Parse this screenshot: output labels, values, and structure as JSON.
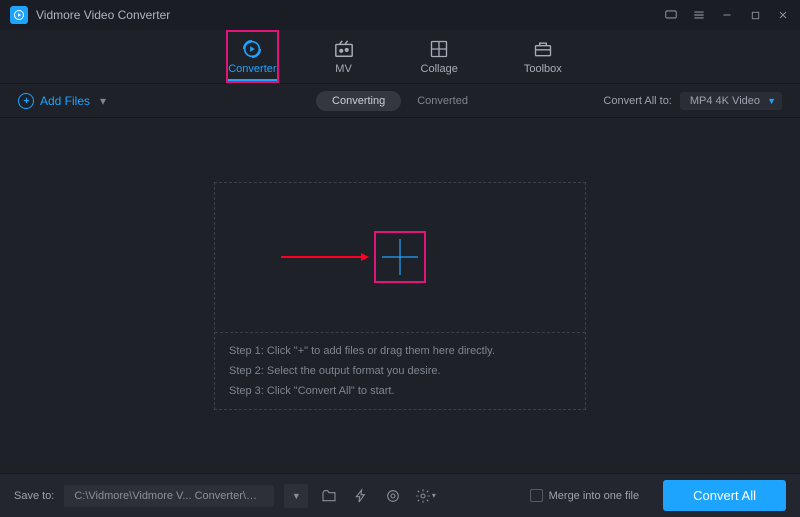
{
  "app": {
    "title": "Vidmore Video Converter"
  },
  "tabs": {
    "converter": "Converter",
    "mv": "MV",
    "collage": "Collage",
    "toolbox": "Toolbox"
  },
  "subbar": {
    "add_files": "Add Files",
    "converting": "Converting",
    "converted": "Converted",
    "convert_all_to": "Convert All to:",
    "format": "MP4 4K Video"
  },
  "steps": {
    "s1": "Step 1: Click \"+\" to add files or drag them here directly.",
    "s2": "Step 2: Select the output format you desire.",
    "s3": "Step 3: Click \"Convert All\" to start."
  },
  "footer": {
    "save_to": "Save to:",
    "path": "C:\\Vidmore\\Vidmore V... Converter\\Converted",
    "merge": "Merge into one file",
    "convert_all": "Convert All"
  }
}
